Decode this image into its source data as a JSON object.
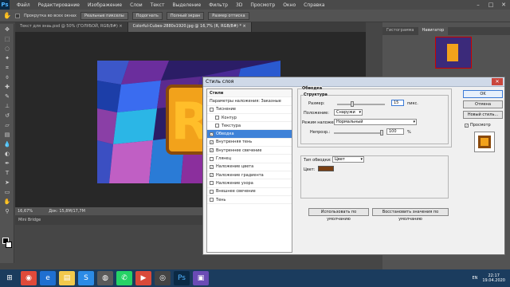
{
  "menu": [
    "Файл",
    "Редактирование",
    "Изображение",
    "Слои",
    "Текст",
    "Выделение",
    "Фильтр",
    "3D",
    "Просмотр",
    "Окно",
    "Справка"
  ],
  "options": {
    "scroll_all": "Прокрутка во всех окнах",
    "actual": "Реальные пикселы",
    "fit": "Подогнать",
    "full": "Полный экран",
    "print": "Размер оттиска"
  },
  "tabs": [
    "Текст для знаь.psd @ 50% (ГОЛУБОЙ, RGB/8#) ×",
    "Colorful-Cubes-2880x1920.jpg @ 16,7% (R, RGB/8#) * ×"
  ],
  "status": {
    "zoom": "16,67%",
    "doc": "Док: 15,8M/17,7M"
  },
  "bridge": "Mini Bridge",
  "panel_tabs": [
    "Гистограмма",
    "Навигатор"
  ],
  "dialog": {
    "title": "Стиль слоя",
    "list": [
      {
        "label": "Стили",
        "type": "hdr"
      },
      {
        "label": "Параметры наложения: Заказные",
        "type": "plain"
      },
      {
        "label": "Тиснение",
        "type": "cb",
        "checked": false
      },
      {
        "label": "Контур",
        "type": "cbind",
        "checked": false
      },
      {
        "label": "Текстура",
        "type": "cbind",
        "checked": false
      },
      {
        "label": "Обводка",
        "type": "cb",
        "checked": true,
        "sel": true
      },
      {
        "label": "Внутренняя тень",
        "type": "cb",
        "checked": true
      },
      {
        "label": "Внутреннее свечение",
        "type": "cb",
        "checked": true
      },
      {
        "label": "Глянец",
        "type": "cb",
        "checked": false
      },
      {
        "label": "Наложение цвета",
        "type": "cb",
        "checked": true
      },
      {
        "label": "Наложение градиента",
        "type": "cb",
        "checked": true
      },
      {
        "label": "Наложение узора",
        "type": "cb",
        "checked": false
      },
      {
        "label": "Внешнее свечение",
        "type": "cb",
        "checked": false
      },
      {
        "label": "Тень",
        "type": "cb",
        "checked": false
      }
    ],
    "stroke": {
      "group": "Обводка",
      "structure": "Структура",
      "size_label": "Размер:",
      "size_value": "15",
      "size_unit": "пикс.",
      "position_label": "Положение:",
      "position_value": "Снаружи",
      "blend_label": "Режим наложения:",
      "blend_value": "Нормальный",
      "opacity_label": "Непрозр.:",
      "opacity_value": "100",
      "opacity_unit": "%",
      "opacity_level": 1.0,
      "size_level": 0.3,
      "fill_type_label": "Тип обводки:",
      "fill_type_value": "Цвет",
      "color_label": "Цвет:",
      "color_hex": "#7a3f12"
    },
    "defaults_btn": "Использовать по умолчанию",
    "reset_btn": "Восстановить значения по умолчанию",
    "ok": "OK",
    "cancel": "Отмена",
    "new_style": "Новый стиль...",
    "preview": "Просмотр"
  },
  "tray": {
    "lang": "EN",
    "time": "22:17",
    "date": "19.04.2020"
  }
}
